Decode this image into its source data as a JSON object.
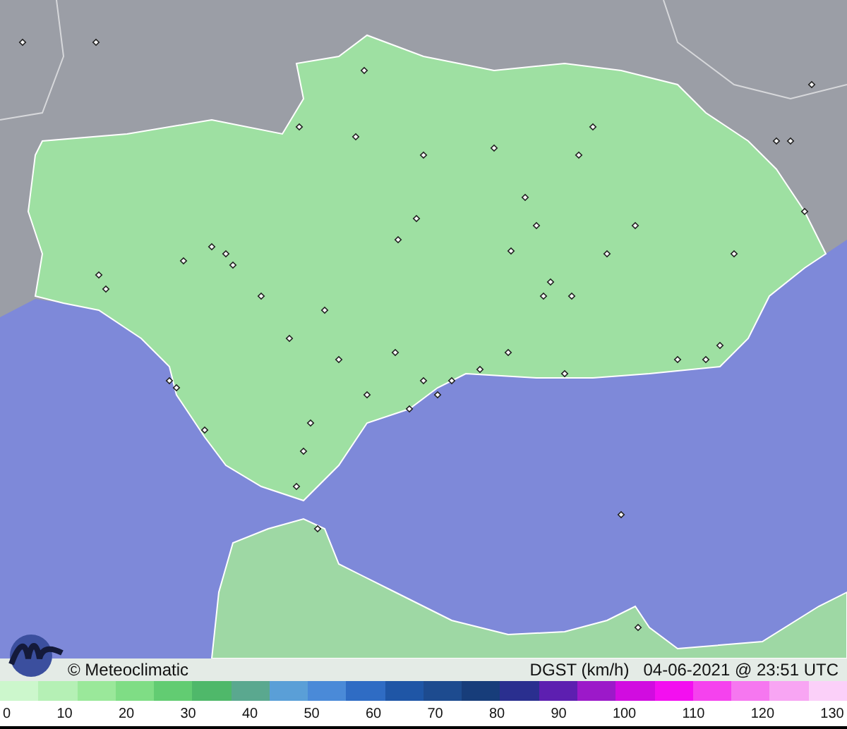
{
  "map": {
    "copyright": "© Meteoclimatic",
    "variable": "DGST (km/h)",
    "timestamp": "04-06-2021 @ 23:51 UTC"
  },
  "scale": {
    "ticks": [
      "0",
      "10",
      "20",
      "30",
      "40",
      "50",
      "60",
      "70",
      "80",
      "90",
      "100",
      "110",
      "120",
      "130"
    ]
  }
}
